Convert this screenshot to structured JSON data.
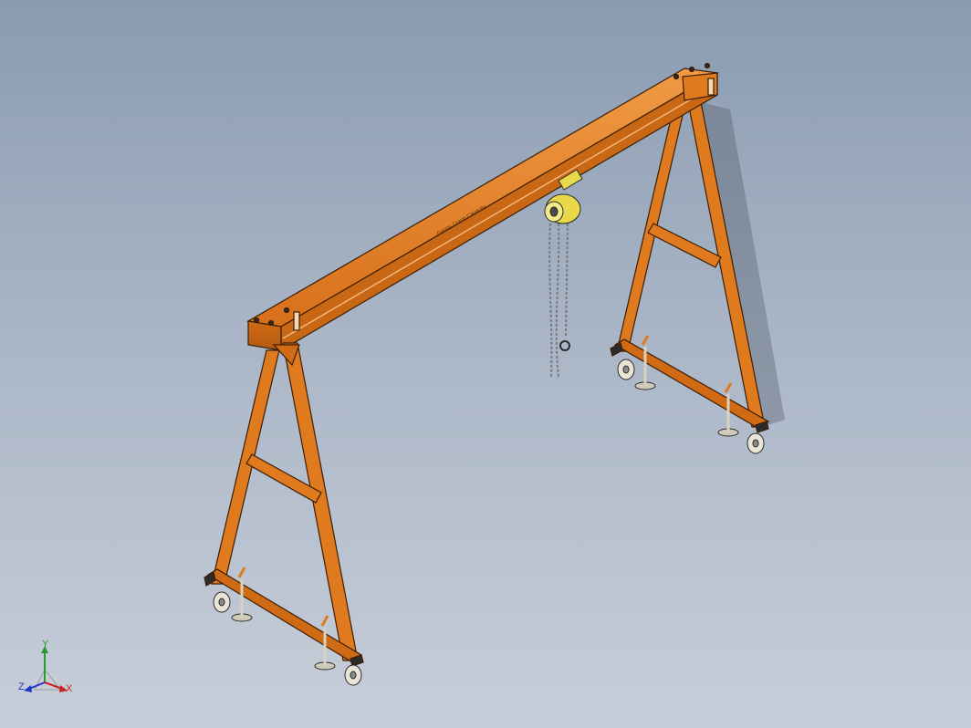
{
  "viewport": {
    "background_top": "#8a9bb0",
    "background_bottom": "#c7ced9"
  },
  "model": {
    "frame_color": "#e07a1f",
    "frame_edge_color": "#3a1e06",
    "hoist_color": "#e8d84a",
    "chain_color": "#7a7a7a",
    "wheel_color": "#e9e4d6",
    "beam_text": "Gantry Crane Capacity"
  },
  "triad": {
    "x_label": "X",
    "y_label": "Y",
    "z_label": "Z",
    "x_color": "#cc2222",
    "y_color": "#2a9a2a",
    "z_color": "#2233cc"
  }
}
